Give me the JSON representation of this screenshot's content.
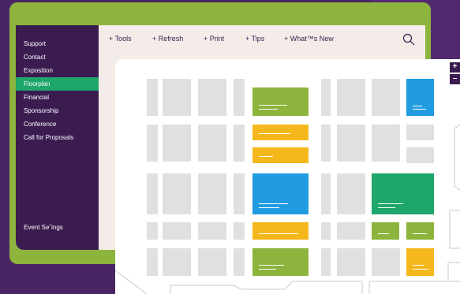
{
  "sidebar": {
    "items": [
      {
        "label": "Support"
      },
      {
        "label": "Contact"
      },
      {
        "label": "Exposition"
      },
      {
        "label": "Floorplan"
      },
      {
        "label": "Financial"
      },
      {
        "label": "Sponsorship"
      },
      {
        "label": "Conference"
      },
      {
        "label": "Call for Proposals"
      }
    ],
    "active_index": 3,
    "bottom_label": "Event Se˜ings"
  },
  "toolbar": {
    "items": [
      {
        "label": "+ Tools"
      },
      {
        "label": "+ Refresh"
      },
      {
        "label": "+ Print"
      },
      {
        "label": "+ Tips"
      },
      {
        "label": "+ What™s New"
      }
    ]
  },
  "zoom": {
    "in_label": "+",
    "out_label": "–"
  },
  "colors": {
    "background": "#4a2566",
    "frame": "#8db43c",
    "sidebar": "#3b1c51",
    "active": "#1fa66a",
    "booth_gray": "#e0e0e0",
    "booth_green": "#8db43c",
    "booth_yellow": "#f5b81c",
    "booth_blue": "#219be0",
    "booth_emerald": "#1fa66a"
  },
  "icons": {
    "search": "search-icon"
  }
}
